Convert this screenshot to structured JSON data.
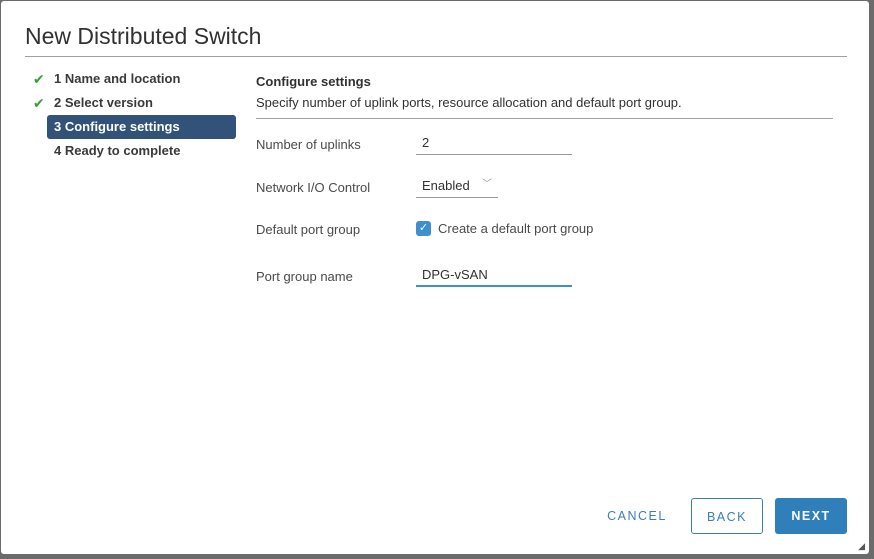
{
  "dialog": {
    "title": "New Distributed Switch"
  },
  "steps": [
    {
      "label": "1 Name and location",
      "completed": true,
      "active": false
    },
    {
      "label": "2 Select version",
      "completed": true,
      "active": false
    },
    {
      "label": "3 Configure settings",
      "completed": false,
      "active": true
    },
    {
      "label": "4 Ready to complete",
      "completed": false,
      "active": false
    }
  ],
  "section": {
    "title": "Configure settings",
    "description": "Specify number of uplink ports, resource allocation and default port group."
  },
  "form": {
    "uplinks": {
      "label": "Number of uplinks",
      "value": "2"
    },
    "nioc": {
      "label": "Network I/O Control",
      "value": "Enabled"
    },
    "default_port_group": {
      "label": "Default port group",
      "checkbox_label": "Create a default port group",
      "checked": true
    },
    "port_group_name": {
      "label": "Port group name",
      "value": "DPG-vSAN"
    }
  },
  "icons": {
    "check": "✔",
    "chevron": "﹀",
    "checkbox_check": "✓",
    "grip": "◢"
  },
  "buttons": {
    "cancel": "CANCEL",
    "back": "BACK",
    "next": "NEXT"
  },
  "colors": {
    "accent": "#2f7fba",
    "active_step": "#325279",
    "check": "#3c9a3c"
  }
}
